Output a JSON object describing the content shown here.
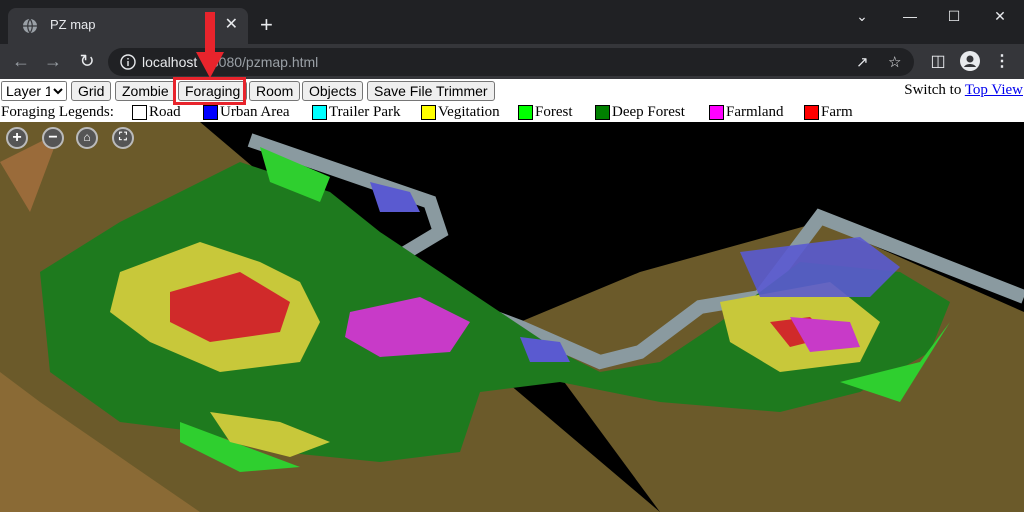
{
  "browser": {
    "tab_title": "PZ map",
    "tab_close": "✕",
    "new_tab": "+",
    "url_host": "localhost",
    "url_rest": ":8080/pzmap.html"
  },
  "toolbar": {
    "layer_select": "Layer 1",
    "buttons": [
      "Grid",
      "Zombie",
      "Foraging",
      "Room",
      "Objects",
      "Save File Trimmer"
    ],
    "switch_text": "Switch to ",
    "switch_link": "Top View"
  },
  "legend": {
    "title": "Foraging Legends:",
    "items": [
      {
        "label": "Road",
        "color": "#ffffff"
      },
      {
        "label": "Urban Area",
        "color": "#0000ff"
      },
      {
        "label": "Trailer Park",
        "color": "#00ffff"
      },
      {
        "label": "Vegitation",
        "color": "#ffff00"
      },
      {
        "label": "Forest",
        "color": "#00ff00"
      },
      {
        "label": "Deep Forest",
        "color": "#008000"
      },
      {
        "label": "Farmland",
        "color": "#ff00ff"
      },
      {
        "label": "Farm",
        "color": "#ff0000"
      }
    ]
  },
  "map": {
    "zoom_controls": [
      "zoom-in-icon",
      "zoom-out-icon",
      "home-icon",
      "fullscreen-icon"
    ],
    "colors": {
      "terrain": "#6b5a2a",
      "deep_forest": "#1e7a1e",
      "forest": "#2fcf2f",
      "vegetation": "#c8c83a",
      "farm": "#d02a2a",
      "farmland": "#c83ac8",
      "urban": "#5a5ad0",
      "river": "#8a9aa0"
    }
  },
  "annotation": {
    "highlight_color": "#e8242c"
  }
}
